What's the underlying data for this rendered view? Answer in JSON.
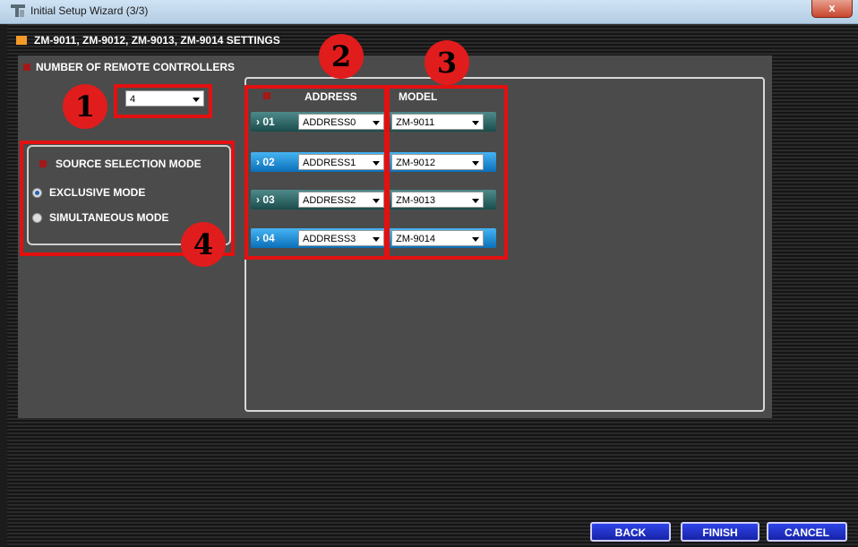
{
  "window": {
    "title": "Initial Setup Wizard (3/3)",
    "close_glyph": "x"
  },
  "section": {
    "title": "ZM-9011, ZM-9012, ZM-9013, ZM-9014 SETTINGS"
  },
  "controllers": {
    "label": "NUMBER OF REMOTE CONTROLLERS",
    "count_value": "4"
  },
  "source_mode": {
    "title": "SOURCE SELECTION MODE",
    "options": [
      {
        "label": "EXCLUSIVE MODE",
        "selected": true
      },
      {
        "label": "SIMULTANEOUS MODE",
        "selected": false
      }
    ]
  },
  "table": {
    "address_header": "ADDRESS",
    "model_header": "MODEL",
    "rows": [
      {
        "num": "› 01",
        "address": "ADDRESS0",
        "model": "ZM-9011",
        "style": "teal"
      },
      {
        "num": "› 02",
        "address": "ADDRESS1",
        "model": "ZM-9012",
        "style": "blue"
      },
      {
        "num": "› 03",
        "address": "ADDRESS2",
        "model": "ZM-9013",
        "style": "teal"
      },
      {
        "num": "› 04",
        "address": "ADDRESS3",
        "model": "ZM-9014",
        "style": "blue"
      }
    ]
  },
  "callouts": [
    "1",
    "2",
    "3",
    "4"
  ],
  "buttons": {
    "back": "BACK",
    "finish": "FINISH",
    "cancel": "CANCEL"
  },
  "colors": {
    "accent_orange": "#f39a28",
    "callout_red": "#e41010",
    "button_blue": "#2034d0"
  }
}
